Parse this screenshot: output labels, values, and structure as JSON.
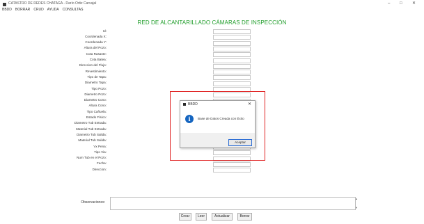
{
  "window": {
    "title": "CATASTRO DE REDES CHATAGA - Darío Ortiz Carvajal",
    "controls": {
      "minimize": "–",
      "maximize": "□",
      "close": "✕"
    }
  },
  "menu": [
    "BBDD",
    "BORRAR",
    "CRUD",
    "AYUDA",
    "CONSULTAS"
  ],
  "heading": "RED DE ALCANTARILLADO CÁMARAS DE INSPECCIÓN",
  "form": {
    "fields": [
      "Id:",
      "Coordenada X:",
      "Coordenada Y:",
      "Altura del Pozo:",
      "Cota Rasante:",
      "Cota Batea:",
      "Direccion del Flujo:",
      "Revestimiento:",
      "Tipo de Tapa:",
      "Diametro Tapa:",
      "Tipo Pozo:",
      "Diametro Pozo:",
      "Diametro Cono:",
      "Altura Cono:",
      "Tipo Cañuela:",
      "Estado Físico:",
      "Diametro Tub Entrada:",
      "Material Tub Entrada:",
      "Diametro Tub Salida:",
      "Material Tub Salida:",
      "Vx Pena:",
      "Tipo Via:",
      "Num Tub en el Pozo:",
      "Fecha:",
      "Direccion:"
    ],
    "observations_label": "Observaciones:"
  },
  "buttons": {
    "crear": "Crear",
    "leer": "Leer",
    "actualizar": "Actualizar",
    "borrar": "Borrar"
  },
  "dialog": {
    "title": "BBDD",
    "close": "✕",
    "message": "Base de Datos Creada con Éxito",
    "icon": "info-icon",
    "ok": "Aceptar"
  },
  "colors": {
    "heading": "#1f9d2a",
    "highlight": "#e02323",
    "info": "#1565c0"
  }
}
